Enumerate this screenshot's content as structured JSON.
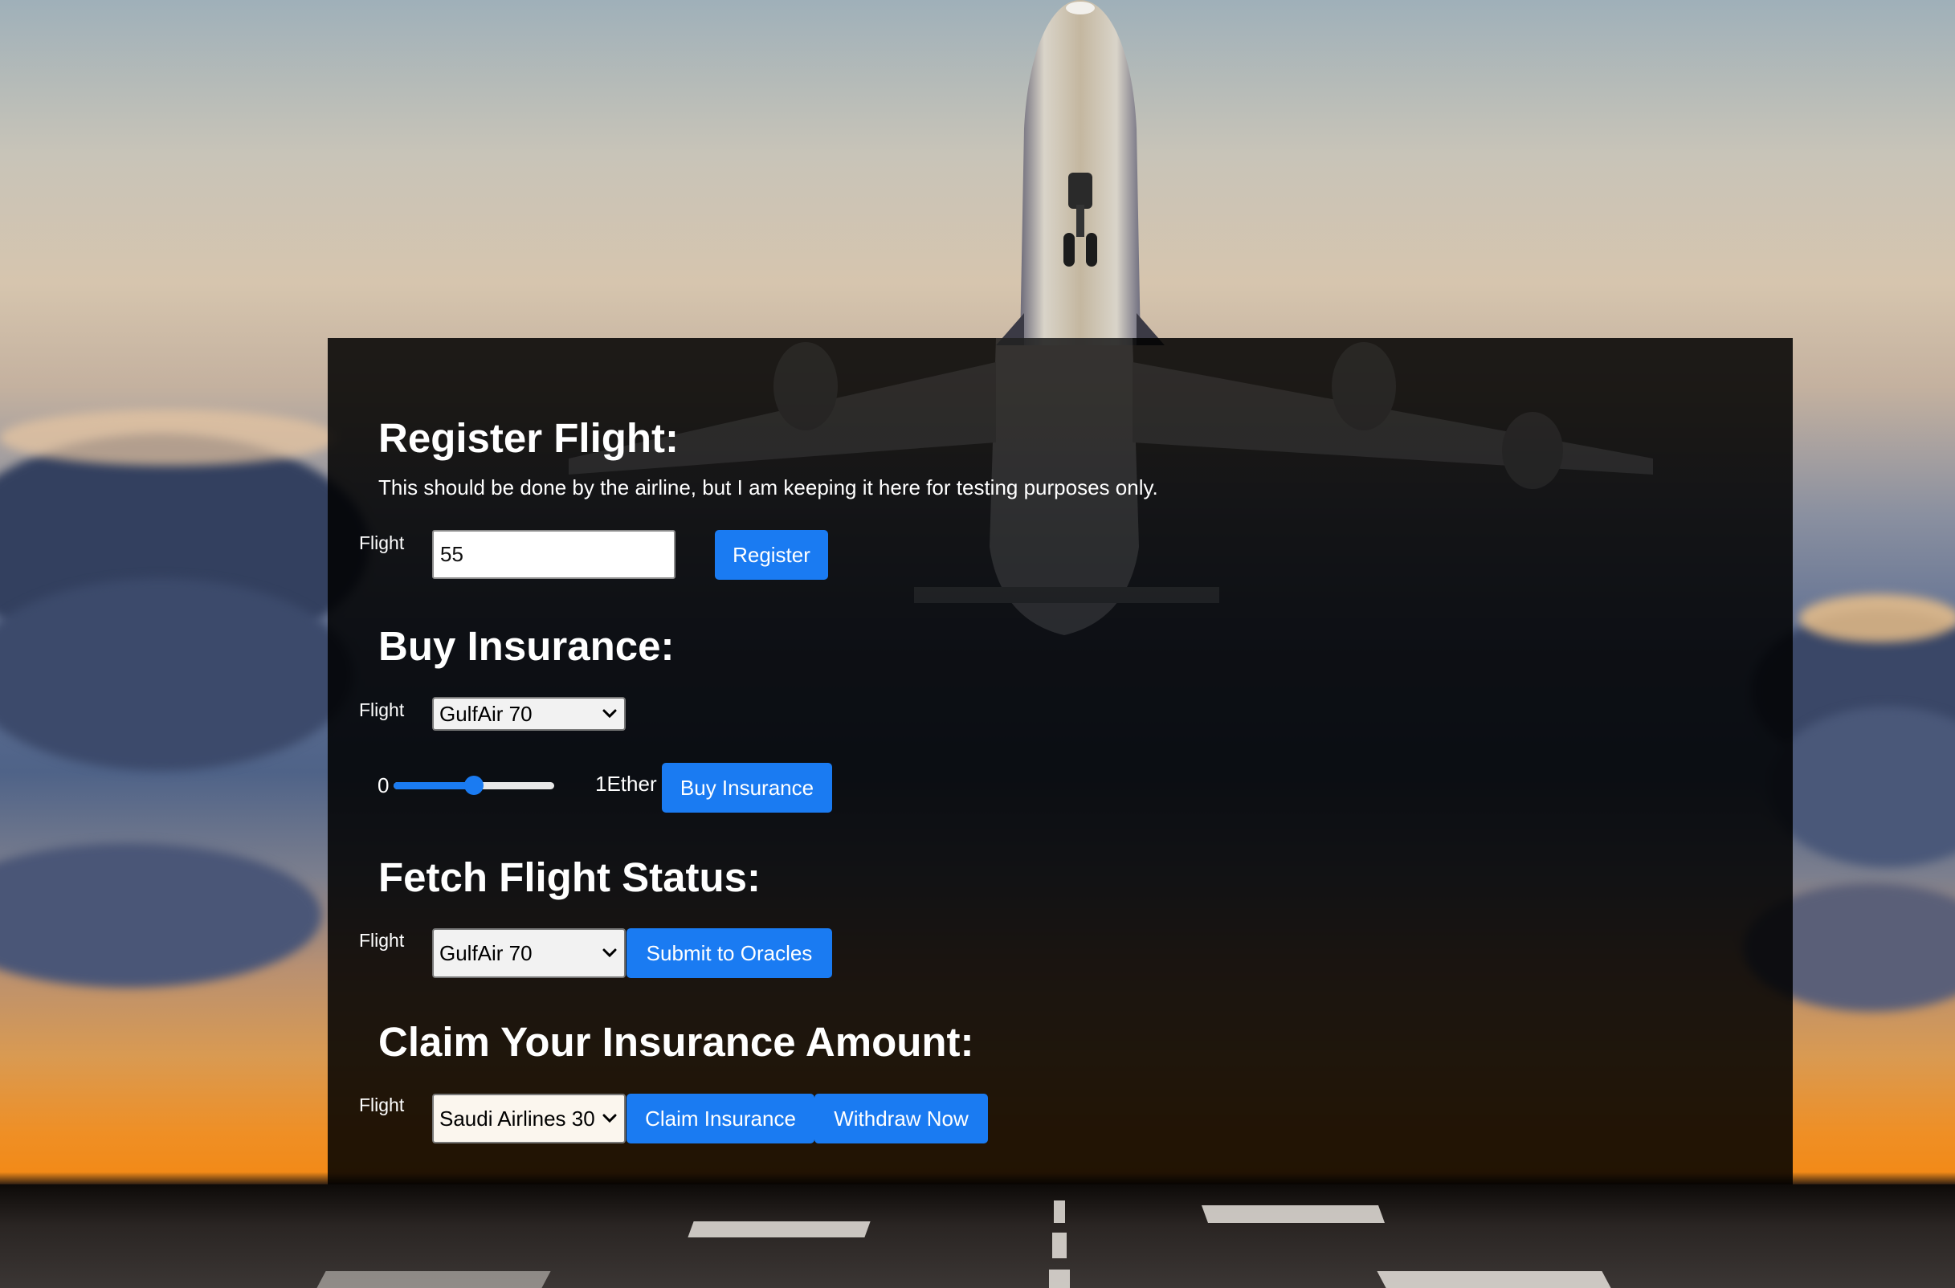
{
  "register": {
    "title": "Register Flight:",
    "note": "This should be done by the airline, but I am keeping it here for testing purposes only.",
    "flight_label": "Flight",
    "flight_value": "55",
    "button": "Register"
  },
  "buy": {
    "title": "Buy Insurance:",
    "flight_label": "Flight",
    "flight_selected": "GulfAir 70",
    "range_min": "0",
    "range_max": "1Ether",
    "amount_fraction": 0.5,
    "button": "Buy Insurance"
  },
  "status": {
    "title": "Fetch Flight Status:",
    "flight_label": "Flight",
    "flight_selected": "GulfAir 70",
    "button": "Submit to Oracles"
  },
  "claim": {
    "title": "Claim Your Insurance Amount:",
    "flight_label": "Flight",
    "flight_selected": "Saudi Airlines 30",
    "claim_button": "Claim Insurance",
    "withdraw_button": "Withdraw Now"
  },
  "colors": {
    "accent": "#1a7bf2",
    "panel": "#000000",
    "text": "#ffffff"
  }
}
